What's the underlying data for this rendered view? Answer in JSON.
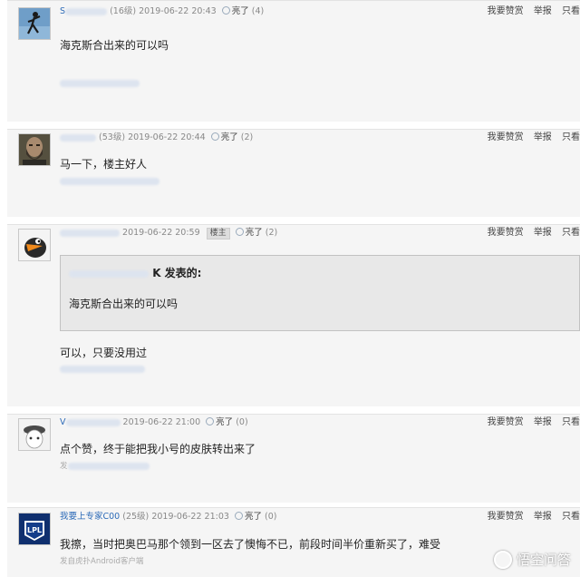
{
  "posts": [
    {
      "username": "S",
      "level": "(16级)",
      "timestamp": "2019-06-22 20:43",
      "lit_label": "亮了",
      "lit_count": "(4)",
      "content": "海克斯合出来的可以吗",
      "client": "",
      "avatar_icon": "skydiver-avatar-icon"
    },
    {
      "username": "",
      "level": "(53级)",
      "timestamp": "2019-06-22 20:44",
      "lit_label": "亮了",
      "lit_count": "(2)",
      "content": "马一下，楼主好人",
      "client": "",
      "avatar_icon": "bearded-man-avatar-icon"
    },
    {
      "username": "",
      "level": "",
      "timestamp": "2019-06-22 20:59",
      "owner_tag": "楼主",
      "lit_label": "亮了",
      "lit_count": "(2)",
      "quote_suffix": "K 发表的:",
      "quote_text": "海克斯合出来的可以吗",
      "content": "可以，只要没用过",
      "client": "",
      "avatar_icon": "cartoon-bird-avatar-icon"
    },
    {
      "username": "V",
      "level": "",
      "timestamp": "2019-06-22 21:00",
      "lit_label": "亮了",
      "lit_count": "(0)",
      "content": "点个赞，终于能把我小号的皮肤转出来了",
      "client": "发",
      "avatar_icon": "anime-girl-avatar-icon"
    },
    {
      "username": "我要上专家C00",
      "level": "(25级)",
      "timestamp": "2019-06-22 21:03",
      "lit_label": "亮了",
      "lit_count": "(0)",
      "content": "我擦，当时把奥巴马那个领到一区去了懊悔不已，前段时间半价重新买了，难受",
      "client": "发自虎扑Android客户端",
      "avatar_icon": "lpl-logo-avatar-icon"
    }
  ],
  "actions": {
    "reward": "我要赞赏",
    "report": "举报",
    "view": "只看"
  },
  "watermark": {
    "text": "悟空问答"
  },
  "colors": {
    "username": "#2d6bb8",
    "post_bg": "#f5f5f5",
    "quote_bg": "#e8e8e8"
  }
}
